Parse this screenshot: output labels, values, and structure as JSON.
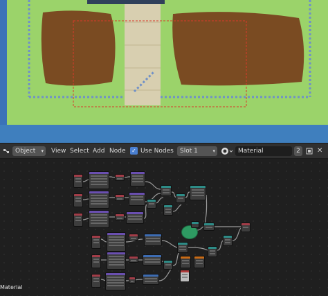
{
  "header": {
    "mode": "Object",
    "menus": [
      "View",
      "Select",
      "Add",
      "Node"
    ],
    "use_nodes_label": "Use Nodes",
    "use_nodes_checked": true,
    "slot": "Slot 1",
    "material_name": "Material",
    "users_count": "2"
  },
  "editor": {
    "label": "Material"
  },
  "colors": {
    "grass": "#9bd36a",
    "soil": "#7a4b22",
    "path": "#d8cfb0",
    "water": "#3a72b8",
    "header_bg": "#303030",
    "editor_bg": "#1f1f1f",
    "node_body": "#3d3d3d",
    "head_texture": "#a23d48",
    "head_purple": "#6a4fb0",
    "head_blue": "#3d6cb2",
    "head_teal": "#2e8c87",
    "head_orange": "#c86b16",
    "head_red": "#b03b3b",
    "frame_node": "#2e9a62"
  }
}
